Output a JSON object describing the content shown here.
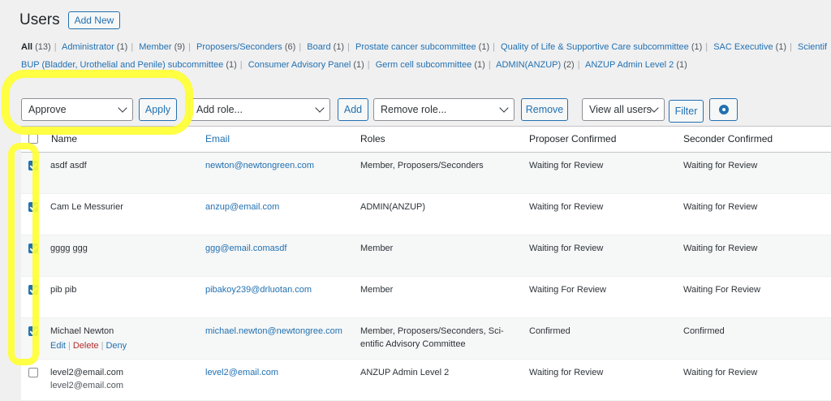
{
  "header": {
    "title": "Users",
    "add_new": "Add New"
  },
  "filters": {
    "row1": [
      {
        "label": "All",
        "count": "(13)",
        "current": true
      },
      {
        "label": "Administrator",
        "count": "(1)"
      },
      {
        "label": "Member",
        "count": "(9)"
      },
      {
        "label": "Proposers/Seconders",
        "count": "(6)"
      },
      {
        "label": "Board",
        "count": "(1)"
      },
      {
        "label": "Prostate cancer subcommittee",
        "count": "(1)"
      },
      {
        "label": "Quality of Life & Supportive Care subcommittee",
        "count": "(1)"
      },
      {
        "label": "SAC Executive",
        "count": "(1)"
      },
      {
        "label": "Scientif",
        "count": ""
      }
    ],
    "row2": [
      {
        "label": "BUP (Bladder, Urothelial and Penile) subcommittee",
        "count": "(1)"
      },
      {
        "label": "Consumer Advisory Panel",
        "count": "(1)"
      },
      {
        "label": "Germ cell subcommittee",
        "count": "(1)"
      },
      {
        "label": "ADMIN(ANZUP)",
        "count": "(2)"
      },
      {
        "label": "ANZUP Admin Level 2",
        "count": "(1)"
      }
    ]
  },
  "toolbar": {
    "bulk_action": "Approve",
    "apply": "Apply",
    "add_role": "Add role...",
    "add": "Add",
    "remove_role": "Remove role...",
    "remove": "Remove",
    "view_all": "View all users",
    "filter": "Filter"
  },
  "table": {
    "columns": {
      "name": "Name",
      "email": "Email",
      "roles": "Roles",
      "proposer": "Proposer Confirmed",
      "seconder": "Seconder Confirmed"
    },
    "rows": [
      {
        "checked": true,
        "name": "asdf asdf",
        "email": "newton@newtongreen.com",
        "roles": "Member, Proposers/Seconders",
        "proposer": "Waiting for Review",
        "seconder": "Waiting for Review"
      },
      {
        "checked": true,
        "name": "Cam Le Messurier",
        "email": "anzup@email.com",
        "roles": "ADMIN(ANZUP)",
        "proposer": "Waiting for Review",
        "seconder": "Waiting for Review"
      },
      {
        "checked": true,
        "name": "gggg ggg",
        "email": "ggg@email.comasdf",
        "roles": "Member",
        "proposer": "Waiting for Review",
        "seconder": "Waiting for Review"
      },
      {
        "checked": true,
        "name": "pib pib",
        "email": "pibakoy239@drluotan.com",
        "roles": "Member",
        "proposer": "Waiting For Review",
        "seconder": "Waiting For Review"
      },
      {
        "checked": true,
        "name": "Michael Newton",
        "email": "michael.newton@newtongree.com",
        "roles": "Member, Proposers/Seconders, Sci-",
        "roles2": "entific Advisory Committee",
        "proposer": "Confirmed",
        "seconder": "Confirmed",
        "actions": {
          "edit": "Edit",
          "delete": "Delete",
          "deny": "Deny"
        }
      },
      {
        "checked": false,
        "name": "level2@email.com",
        "name2": "level2@email.com",
        "email": "level2@email.com",
        "roles": "ANZUP Admin Level 2",
        "proposer": "Waiting for Review",
        "seconder": "Waiting for Review"
      }
    ]
  }
}
